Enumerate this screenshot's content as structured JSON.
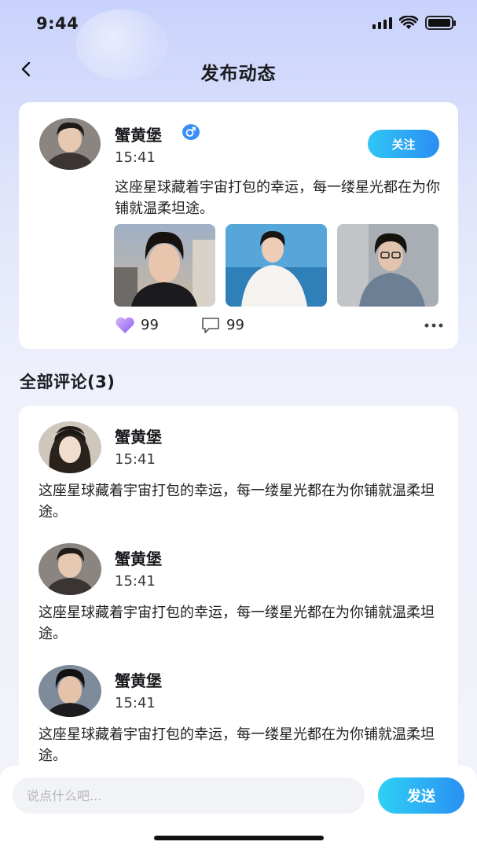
{
  "status_bar": {
    "time": "9:44"
  },
  "header": {
    "title": "发布动态"
  },
  "post": {
    "author": "蟹黄堡",
    "time": "15:41",
    "follow_label": "关注",
    "text": "这座星球藏着宇宙打包的幸运，每一缕星光都在为你铺就温柔坦途。",
    "likes": "99",
    "comments": "99"
  },
  "comments_section": {
    "title": "全部评论(3)",
    "items": [
      {
        "author": "蟹黄堡",
        "time": "15:41",
        "text": "这座星球藏着宇宙打包的幸运，每一缕星光都在为你铺就温柔坦途。"
      },
      {
        "author": "蟹黄堡",
        "time": "15:41",
        "text": "这座星球藏着宇宙打包的幸运，每一缕星光都在为你铺就温柔坦途。"
      },
      {
        "author": "蟹黄堡",
        "time": "15:41",
        "text": "这座星球藏着宇宙打包的幸运，每一缕星光都在为你铺就温柔坦途。"
      }
    ]
  },
  "input_bar": {
    "placeholder": "说点什么吧...",
    "send_label": "发送"
  },
  "colors": {
    "accent": "#2a8ef2",
    "like": "#a77cf0"
  },
  "icons": [
    "back-icon",
    "male-icon",
    "heart-icon",
    "comment-icon",
    "more-icon"
  ]
}
